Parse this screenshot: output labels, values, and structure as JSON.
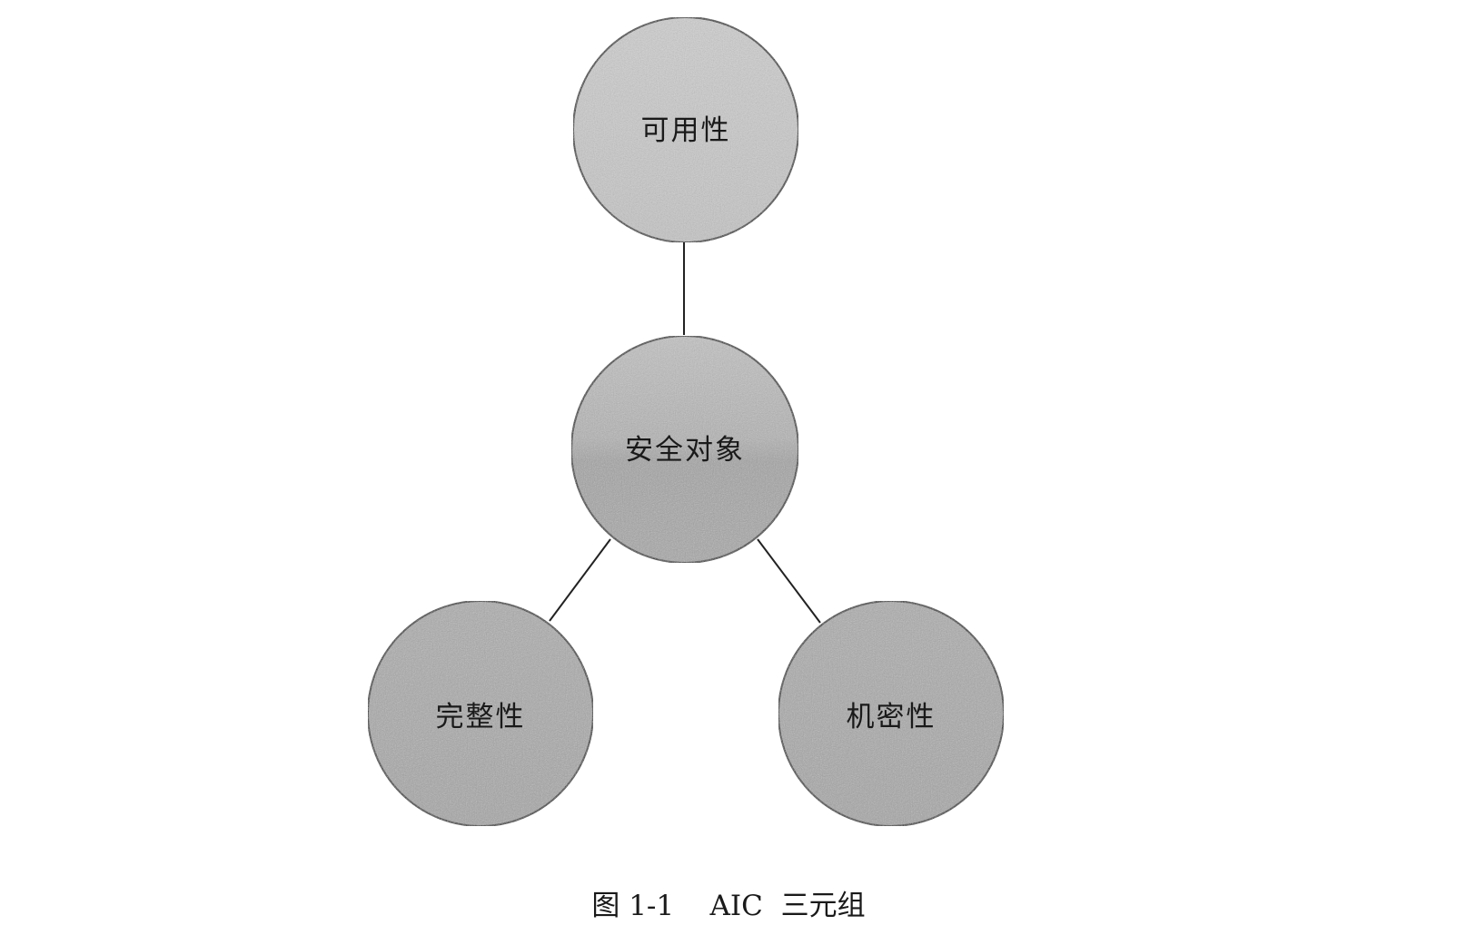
{
  "diagram": {
    "nodes": {
      "top": {
        "label": "可用性"
      },
      "center": {
        "label": "安全对象"
      },
      "bottom_left": {
        "label": "完整性"
      },
      "bottom_right": {
        "label": "机密性"
      }
    },
    "edges": [
      {
        "from": "center",
        "to": "top"
      },
      {
        "from": "center",
        "to": "bottom_left"
      },
      {
        "from": "center",
        "to": "bottom_right"
      }
    ]
  },
  "caption": "图 1-1    AIC  三元组"
}
